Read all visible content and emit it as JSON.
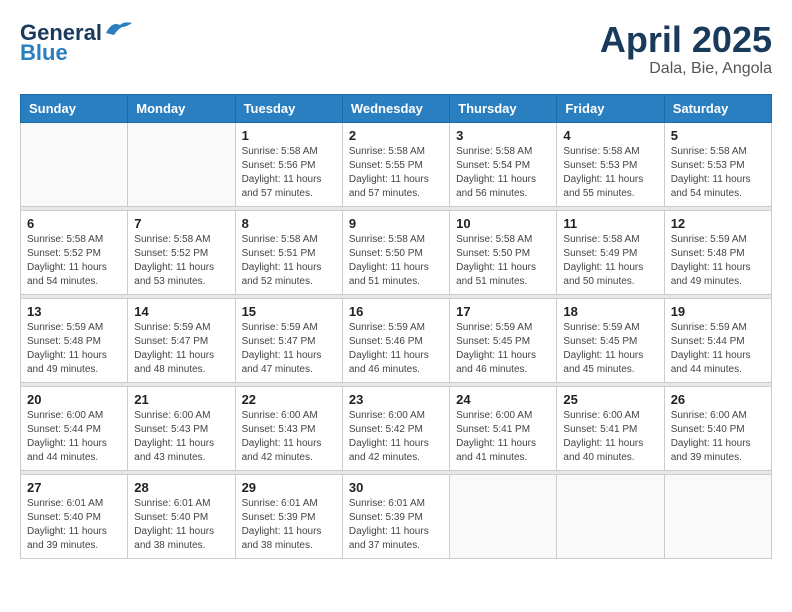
{
  "header": {
    "logo_line1": "General",
    "logo_line2": "Blue",
    "title": "April 2025",
    "subtitle": "Dala, Bie, Angola"
  },
  "weekdays": [
    "Sunday",
    "Monday",
    "Tuesday",
    "Wednesday",
    "Thursday",
    "Friday",
    "Saturday"
  ],
  "weeks": [
    [
      {
        "day": "",
        "info": ""
      },
      {
        "day": "",
        "info": ""
      },
      {
        "day": "1",
        "info": "Sunrise: 5:58 AM\nSunset: 5:56 PM\nDaylight: 11 hours and 57 minutes."
      },
      {
        "day": "2",
        "info": "Sunrise: 5:58 AM\nSunset: 5:55 PM\nDaylight: 11 hours and 57 minutes."
      },
      {
        "day": "3",
        "info": "Sunrise: 5:58 AM\nSunset: 5:54 PM\nDaylight: 11 hours and 56 minutes."
      },
      {
        "day": "4",
        "info": "Sunrise: 5:58 AM\nSunset: 5:53 PM\nDaylight: 11 hours and 55 minutes."
      },
      {
        "day": "5",
        "info": "Sunrise: 5:58 AM\nSunset: 5:53 PM\nDaylight: 11 hours and 54 minutes."
      }
    ],
    [
      {
        "day": "6",
        "info": "Sunrise: 5:58 AM\nSunset: 5:52 PM\nDaylight: 11 hours and 54 minutes."
      },
      {
        "day": "7",
        "info": "Sunrise: 5:58 AM\nSunset: 5:52 PM\nDaylight: 11 hours and 53 minutes."
      },
      {
        "day": "8",
        "info": "Sunrise: 5:58 AM\nSunset: 5:51 PM\nDaylight: 11 hours and 52 minutes."
      },
      {
        "day": "9",
        "info": "Sunrise: 5:58 AM\nSunset: 5:50 PM\nDaylight: 11 hours and 51 minutes."
      },
      {
        "day": "10",
        "info": "Sunrise: 5:58 AM\nSunset: 5:50 PM\nDaylight: 11 hours and 51 minutes."
      },
      {
        "day": "11",
        "info": "Sunrise: 5:58 AM\nSunset: 5:49 PM\nDaylight: 11 hours and 50 minutes."
      },
      {
        "day": "12",
        "info": "Sunrise: 5:59 AM\nSunset: 5:48 PM\nDaylight: 11 hours and 49 minutes."
      }
    ],
    [
      {
        "day": "13",
        "info": "Sunrise: 5:59 AM\nSunset: 5:48 PM\nDaylight: 11 hours and 49 minutes."
      },
      {
        "day": "14",
        "info": "Sunrise: 5:59 AM\nSunset: 5:47 PM\nDaylight: 11 hours and 48 minutes."
      },
      {
        "day": "15",
        "info": "Sunrise: 5:59 AM\nSunset: 5:47 PM\nDaylight: 11 hours and 47 minutes."
      },
      {
        "day": "16",
        "info": "Sunrise: 5:59 AM\nSunset: 5:46 PM\nDaylight: 11 hours and 46 minutes."
      },
      {
        "day": "17",
        "info": "Sunrise: 5:59 AM\nSunset: 5:45 PM\nDaylight: 11 hours and 46 minutes."
      },
      {
        "day": "18",
        "info": "Sunrise: 5:59 AM\nSunset: 5:45 PM\nDaylight: 11 hours and 45 minutes."
      },
      {
        "day": "19",
        "info": "Sunrise: 5:59 AM\nSunset: 5:44 PM\nDaylight: 11 hours and 44 minutes."
      }
    ],
    [
      {
        "day": "20",
        "info": "Sunrise: 6:00 AM\nSunset: 5:44 PM\nDaylight: 11 hours and 44 minutes."
      },
      {
        "day": "21",
        "info": "Sunrise: 6:00 AM\nSunset: 5:43 PM\nDaylight: 11 hours and 43 minutes."
      },
      {
        "day": "22",
        "info": "Sunrise: 6:00 AM\nSunset: 5:43 PM\nDaylight: 11 hours and 42 minutes."
      },
      {
        "day": "23",
        "info": "Sunrise: 6:00 AM\nSunset: 5:42 PM\nDaylight: 11 hours and 42 minutes."
      },
      {
        "day": "24",
        "info": "Sunrise: 6:00 AM\nSunset: 5:41 PM\nDaylight: 11 hours and 41 minutes."
      },
      {
        "day": "25",
        "info": "Sunrise: 6:00 AM\nSunset: 5:41 PM\nDaylight: 11 hours and 40 minutes."
      },
      {
        "day": "26",
        "info": "Sunrise: 6:00 AM\nSunset: 5:40 PM\nDaylight: 11 hours and 39 minutes."
      }
    ],
    [
      {
        "day": "27",
        "info": "Sunrise: 6:01 AM\nSunset: 5:40 PM\nDaylight: 11 hours and 39 minutes."
      },
      {
        "day": "28",
        "info": "Sunrise: 6:01 AM\nSunset: 5:40 PM\nDaylight: 11 hours and 38 minutes."
      },
      {
        "day": "29",
        "info": "Sunrise: 6:01 AM\nSunset: 5:39 PM\nDaylight: 11 hours and 38 minutes."
      },
      {
        "day": "30",
        "info": "Sunrise: 6:01 AM\nSunset: 5:39 PM\nDaylight: 11 hours and 37 minutes."
      },
      {
        "day": "",
        "info": ""
      },
      {
        "day": "",
        "info": ""
      },
      {
        "day": "",
        "info": ""
      }
    ]
  ]
}
